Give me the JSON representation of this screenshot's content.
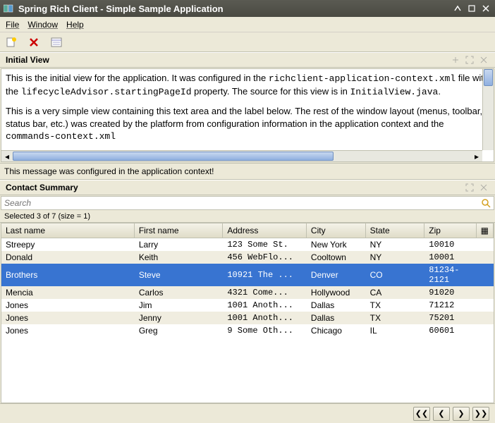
{
  "window": {
    "title": "Spring Rich Client - Simple Sample Application"
  },
  "menubar": {
    "file": "File",
    "window": "Window",
    "help": "Help"
  },
  "initial_view": {
    "header": "Initial View",
    "para1_pre": "This is the initial view for the application. It was configured in the ",
    "code1": "richclient-application-context.xml",
    "para1_mid": " file with the ",
    "code2": "lifecycleAdvisor.startingPageId",
    "para1_post": " property. The source for this view is in ",
    "code3": "InitialView.java",
    "para1_end": ".",
    "para2_pre": "This is a very simple view containing this text area and the label below. The rest of the window layout (menus, toolbar, status bar, etc.) was created by the platform from configuration information in the application context and the ",
    "code4": "commands-context.xml"
  },
  "status_message": "This message was configured in the application context!",
  "contact": {
    "header": "Contact Summary",
    "search_placeholder": "Search",
    "selection_info": "Selected 3 of 7 (size = 1)",
    "columns": {
      "last": "Last name",
      "first": "First name",
      "address": "Address",
      "city": "City",
      "state": "State",
      "zip": "Zip"
    },
    "rows": [
      {
        "last": "Streepy",
        "first": "Larry",
        "address": "123 Some St.",
        "city": "New York",
        "state": "NY",
        "zip": "10010",
        "sel": false
      },
      {
        "last": "Donald",
        "first": "Keith",
        "address": "456 WebFlo...",
        "city": "Cooltown",
        "state": "NY",
        "zip": "10001",
        "sel": false
      },
      {
        "last": "Brothers",
        "first": "Steve",
        "address": "10921 The ...",
        "city": "Denver",
        "state": "CO",
        "zip": "81234-2121",
        "sel": true
      },
      {
        "last": "Mencia",
        "first": "Carlos",
        "address": "4321 Come...",
        "city": "Hollywood",
        "state": "CA",
        "zip": "91020",
        "sel": false
      },
      {
        "last": "Jones",
        "first": "Jim",
        "address": "1001 Anoth...",
        "city": "Dallas",
        "state": "TX",
        "zip": "71212",
        "sel": false
      },
      {
        "last": "Jones",
        "first": "Jenny",
        "address": "1001 Anoth...",
        "city": "Dallas",
        "state": "TX",
        "zip": "75201",
        "sel": false
      },
      {
        "last": "Jones",
        "first": "Greg",
        "address": "9 Some Oth...",
        "city": "Chicago",
        "state": "IL",
        "zip": "60601",
        "sel": false
      }
    ]
  },
  "nav": {
    "first": "❮❮",
    "prev": "❮",
    "next": "❯",
    "last": "❯❯"
  }
}
